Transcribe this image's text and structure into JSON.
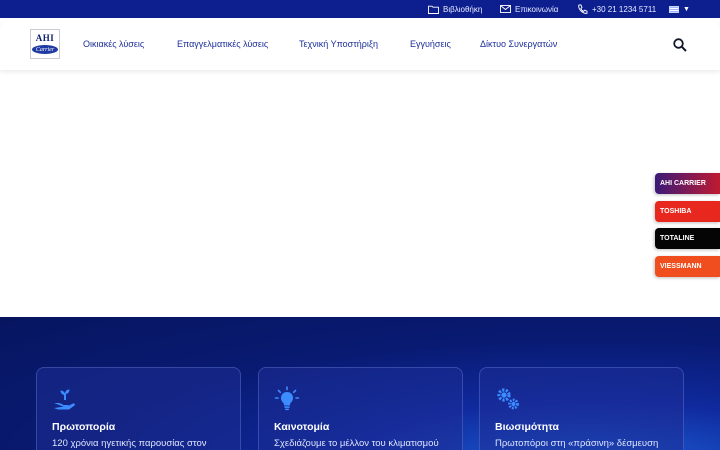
{
  "utility_bar": {
    "library_label": "Βιβλιοθήκη",
    "contact_label": "Επικοινωνία",
    "phone": "+30 21 1234 5711",
    "language_icon": "flag-icon"
  },
  "logo": {
    "top_text": "AHI",
    "oval_text": "Carrier"
  },
  "nav": {
    "items": [
      {
        "label": "Οικιακές λύσεις"
      },
      {
        "label": "Επαγγελματικές λύσεις"
      },
      {
        "label": "Τεχνική Υποστήριξη"
      },
      {
        "label": "Εγγυήσεις"
      },
      {
        "label": "Δίκτυο Συνεργατών"
      }
    ]
  },
  "brands": [
    {
      "label": "AHI CARRIER",
      "color": "#8a1a50"
    },
    {
      "label": "TOSHIBA",
      "color": "#e8281e"
    },
    {
      "label": "TOTALINE",
      "color": "#050505"
    },
    {
      "label": "VIESSMANN",
      "color": "#f04e1f"
    }
  ],
  "features": [
    {
      "icon": "hand-plant-icon",
      "title": "Πρωτοπορία",
      "text": "120 χρόνια ηγετικής παρουσίας στον"
    },
    {
      "icon": "lightbulb-icon",
      "title": "Καινοτομία",
      "text": "Σχεδιάζουμε το μέλλον του κλιματισμού"
    },
    {
      "icon": "gears-icon",
      "title": "Βιωσιμότητα",
      "text": "Πρωτοπόροι στη «πράσινη» δέσμευση"
    }
  ],
  "colors": {
    "primary": "#0d1f8f",
    "nav_text": "#1d2f9a",
    "accent_icon": "#3d8cff"
  }
}
